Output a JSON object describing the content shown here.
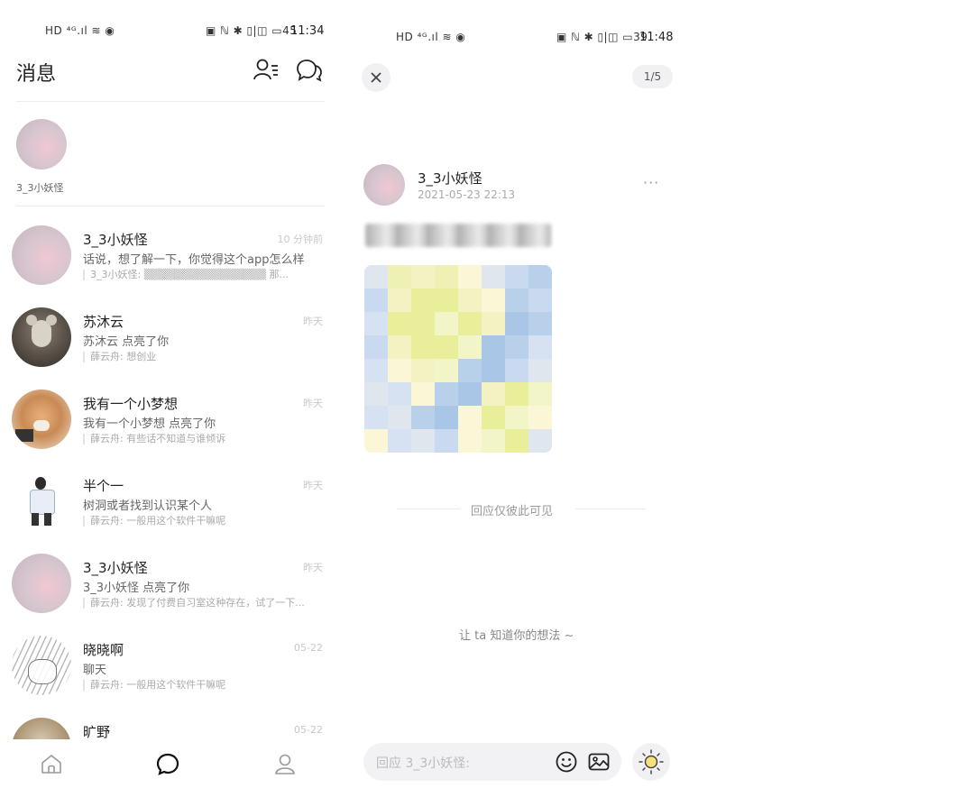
{
  "left": {
    "status": {
      "signal": "HD ⁴ᴳ.ıl ≋ ◉",
      "right_icons": "▣ ℕ ✱ ▯|◫ ▭45",
      "time": "11:34"
    },
    "title": "消息",
    "story": {
      "name": "3_3小妖怪"
    },
    "rows": [
      {
        "name": "3_3小妖怪",
        "time": "10 分钟前",
        "sub": "话说，想了解一下，你觉得这个app怎么样",
        "quote": "3_3小妖怪: ▒▒▒▒▒▒▒▒▒▒▒▒▒▒▒▒ 那..."
      },
      {
        "name": "苏沐云",
        "time": "昨天",
        "sub": "苏沐云 点亮了你",
        "quote": "薛云舟: 想创业"
      },
      {
        "name": "我有一个小梦想",
        "time": "昨天",
        "sub": "我有一个小梦想 点亮了你",
        "quote": "薛云舟: 有些话不知道与谁倾诉"
      },
      {
        "name": "半个一",
        "time": "昨天",
        "sub": "树洞或者找到认识某个人",
        "quote": "薛云舟: 一般用这个软件干嘛呢"
      },
      {
        "name": "3_3小妖怪",
        "time": "昨天",
        "sub": "3_3小妖怪 点亮了你",
        "quote": "薛云舟: 发现了付费自习室这种存在，试了一下..."
      },
      {
        "name": "晓晓啊",
        "time": "05-22",
        "sub": "聊天",
        "quote": "薛云舟: 一般用这个软件干嘛呢"
      },
      {
        "name": "旷野",
        "time": "05-22",
        "sub": "",
        "quote": ""
      }
    ],
    "nav": [
      "home-icon",
      "chat-icon",
      "profile-icon"
    ]
  },
  "right": {
    "status": {
      "signal": "HD ⁴ᴳ.ıl ≋ ◉",
      "right_icons": "▣ ℕ ✱ ▯|◫ ▭39",
      "time": "11:48"
    },
    "page_indicator": "1/5",
    "post": {
      "author": "3_3小妖怪",
      "date": "2021-05-23 22:13",
      "more": "···"
    },
    "visibility_note": "回应仅彼此可见",
    "prompt": "让 ta 知道你的想法 ~",
    "reply_placeholder": "回应 3_3小妖怪:"
  },
  "colors": {
    "mosaic": [
      "#dfe6ee",
      "#c9daf0",
      "#eef0b4",
      "#f4f1c2",
      "#b8d0ea",
      "#fbf6d6",
      "#e9ee9a",
      "#d6e2f1",
      "#f2f5c8",
      "#a9c6e6"
    ]
  }
}
